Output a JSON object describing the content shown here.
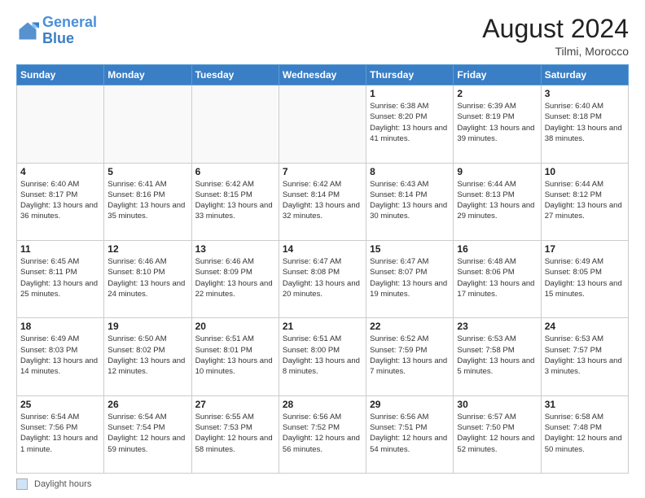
{
  "header": {
    "logo": {
      "line1": "General",
      "line2": "Blue"
    },
    "month_year": "August 2024",
    "location": "Tilmi, Morocco"
  },
  "days_of_week": [
    "Sunday",
    "Monday",
    "Tuesday",
    "Wednesday",
    "Thursday",
    "Friday",
    "Saturday"
  ],
  "weeks": [
    [
      {
        "day": "",
        "info": ""
      },
      {
        "day": "",
        "info": ""
      },
      {
        "day": "",
        "info": ""
      },
      {
        "day": "",
        "info": ""
      },
      {
        "day": "1",
        "info": "Sunrise: 6:38 AM\nSunset: 8:20 PM\nDaylight: 13 hours and 41 minutes."
      },
      {
        "day": "2",
        "info": "Sunrise: 6:39 AM\nSunset: 8:19 PM\nDaylight: 13 hours and 39 minutes."
      },
      {
        "day": "3",
        "info": "Sunrise: 6:40 AM\nSunset: 8:18 PM\nDaylight: 13 hours and 38 minutes."
      }
    ],
    [
      {
        "day": "4",
        "info": "Sunrise: 6:40 AM\nSunset: 8:17 PM\nDaylight: 13 hours and 36 minutes."
      },
      {
        "day": "5",
        "info": "Sunrise: 6:41 AM\nSunset: 8:16 PM\nDaylight: 13 hours and 35 minutes."
      },
      {
        "day": "6",
        "info": "Sunrise: 6:42 AM\nSunset: 8:15 PM\nDaylight: 13 hours and 33 minutes."
      },
      {
        "day": "7",
        "info": "Sunrise: 6:42 AM\nSunset: 8:14 PM\nDaylight: 13 hours and 32 minutes."
      },
      {
        "day": "8",
        "info": "Sunrise: 6:43 AM\nSunset: 8:14 PM\nDaylight: 13 hours and 30 minutes."
      },
      {
        "day": "9",
        "info": "Sunrise: 6:44 AM\nSunset: 8:13 PM\nDaylight: 13 hours and 29 minutes."
      },
      {
        "day": "10",
        "info": "Sunrise: 6:44 AM\nSunset: 8:12 PM\nDaylight: 13 hours and 27 minutes."
      }
    ],
    [
      {
        "day": "11",
        "info": "Sunrise: 6:45 AM\nSunset: 8:11 PM\nDaylight: 13 hours and 25 minutes."
      },
      {
        "day": "12",
        "info": "Sunrise: 6:46 AM\nSunset: 8:10 PM\nDaylight: 13 hours and 24 minutes."
      },
      {
        "day": "13",
        "info": "Sunrise: 6:46 AM\nSunset: 8:09 PM\nDaylight: 13 hours and 22 minutes."
      },
      {
        "day": "14",
        "info": "Sunrise: 6:47 AM\nSunset: 8:08 PM\nDaylight: 13 hours and 20 minutes."
      },
      {
        "day": "15",
        "info": "Sunrise: 6:47 AM\nSunset: 8:07 PM\nDaylight: 13 hours and 19 minutes."
      },
      {
        "day": "16",
        "info": "Sunrise: 6:48 AM\nSunset: 8:06 PM\nDaylight: 13 hours and 17 minutes."
      },
      {
        "day": "17",
        "info": "Sunrise: 6:49 AM\nSunset: 8:05 PM\nDaylight: 13 hours and 15 minutes."
      }
    ],
    [
      {
        "day": "18",
        "info": "Sunrise: 6:49 AM\nSunset: 8:03 PM\nDaylight: 13 hours and 14 minutes."
      },
      {
        "day": "19",
        "info": "Sunrise: 6:50 AM\nSunset: 8:02 PM\nDaylight: 13 hours and 12 minutes."
      },
      {
        "day": "20",
        "info": "Sunrise: 6:51 AM\nSunset: 8:01 PM\nDaylight: 13 hours and 10 minutes."
      },
      {
        "day": "21",
        "info": "Sunrise: 6:51 AM\nSunset: 8:00 PM\nDaylight: 13 hours and 8 minutes."
      },
      {
        "day": "22",
        "info": "Sunrise: 6:52 AM\nSunset: 7:59 PM\nDaylight: 13 hours and 7 minutes."
      },
      {
        "day": "23",
        "info": "Sunrise: 6:53 AM\nSunset: 7:58 PM\nDaylight: 13 hours and 5 minutes."
      },
      {
        "day": "24",
        "info": "Sunrise: 6:53 AM\nSunset: 7:57 PM\nDaylight: 13 hours and 3 minutes."
      }
    ],
    [
      {
        "day": "25",
        "info": "Sunrise: 6:54 AM\nSunset: 7:56 PM\nDaylight: 13 hours and 1 minute."
      },
      {
        "day": "26",
        "info": "Sunrise: 6:54 AM\nSunset: 7:54 PM\nDaylight: 12 hours and 59 minutes."
      },
      {
        "day": "27",
        "info": "Sunrise: 6:55 AM\nSunset: 7:53 PM\nDaylight: 12 hours and 58 minutes."
      },
      {
        "day": "28",
        "info": "Sunrise: 6:56 AM\nSunset: 7:52 PM\nDaylight: 12 hours and 56 minutes."
      },
      {
        "day": "29",
        "info": "Sunrise: 6:56 AM\nSunset: 7:51 PM\nDaylight: 12 hours and 54 minutes."
      },
      {
        "day": "30",
        "info": "Sunrise: 6:57 AM\nSunset: 7:50 PM\nDaylight: 12 hours and 52 minutes."
      },
      {
        "day": "31",
        "info": "Sunrise: 6:58 AM\nSunset: 7:48 PM\nDaylight: 12 hours and 50 minutes."
      }
    ]
  ],
  "legend": {
    "label": "Daylight hours"
  }
}
